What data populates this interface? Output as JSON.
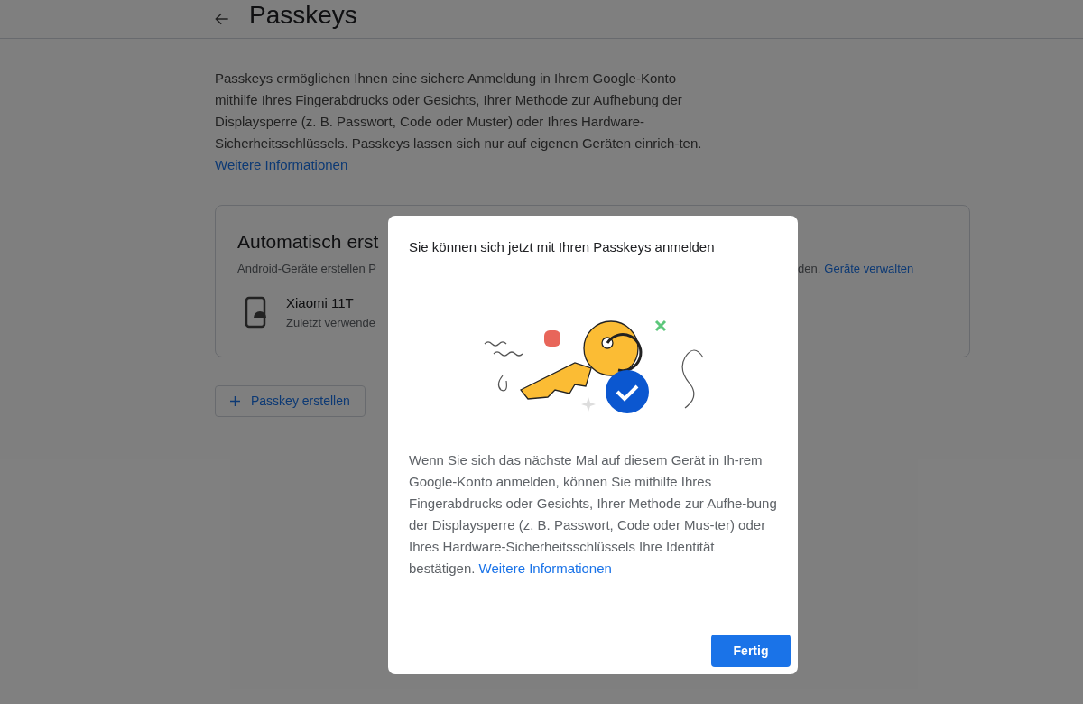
{
  "header": {
    "title": "Passkeys"
  },
  "intro": {
    "text": "Passkeys ermöglichen Ihnen eine sichere Anmeldung in Ihrem Google-Konto mithilfe Ihres Fingerabdrucks oder Gesichts, Ihrer Methode zur Aufhebung der Displaysperre (z. B. Passwort, Code oder Muster) oder Ihres Hardware-Sicherheitsschlüssels. Passkeys lassen sich nur auf eigenen Geräten einrich-ten.",
    "link": "Weitere Informationen"
  },
  "card": {
    "title": "Automatisch erst",
    "subtitle_start": "Android-Geräte erstellen P",
    "subtitle_end": "den.",
    "link": "Geräte verwalten",
    "devices": [
      {
        "name": "Xiaomi 11T",
        "detail": "Zuletzt verwende"
      }
    ]
  },
  "create_button": {
    "label": "Passkey erstellen"
  },
  "dialog": {
    "title": "Sie können sich jetzt mit Ihren Passkeys anmelden",
    "body": "Wenn Sie sich das nächste Mal auf diesem Gerät in Ih-rem Google-Konto anmelden, können Sie mithilfe Ihres Fingerabdrucks oder Gesichts, Ihrer Methode zur Aufhe-bung der Displaysperre (z. B. Passwort, Code oder Mus-ter) oder Ihres Hardware-Sicherheitsschlüssels Ihre Identität bestätigen.",
    "link": "Weitere Informationen",
    "button": "Fertig"
  }
}
